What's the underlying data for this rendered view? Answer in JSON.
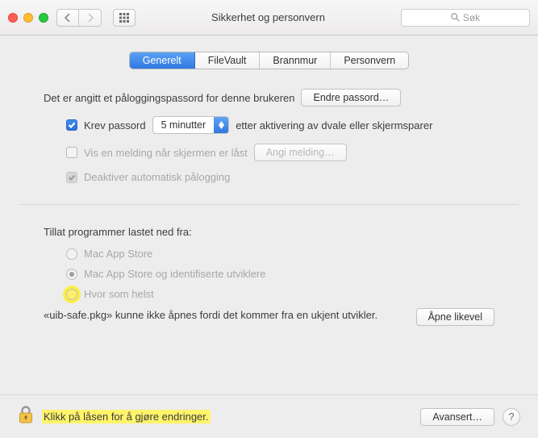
{
  "window": {
    "title": "Sikkerhet og personvern",
    "search_placeholder": "Søk"
  },
  "tabs": {
    "general": "Generelt",
    "filevault": "FileVault",
    "firewall": "Brannmur",
    "privacy": "Personvern"
  },
  "general": {
    "login_password_set": "Det er angitt et påloggingspassord for denne brukeren",
    "change_password": "Endre passord…",
    "require_password": "Krev passord",
    "delay_selected": "5 minutter",
    "after_sleep": "etter aktivering av dvale eller skjermsparer",
    "show_message": "Vis en melding når skjermen er låst",
    "set_message": "Angi melding…",
    "disable_auto_login": "Deaktiver automatisk pålogging"
  },
  "allow": {
    "title": "Tillat programmer lastet ned fra:",
    "mas": "Mac App Store",
    "mas_dev": "Mac App Store og identifiserte utviklere",
    "anywhere": "Hvor som helst",
    "blocked_msg": "«uib-safe.pkg» kunne ikke åpnes fordi det kommer fra en ukjent utvikler.",
    "open_anyway": "Åpne likevel"
  },
  "footer": {
    "lock_text": "Klikk på låsen for å gjøre endringer.",
    "advanced": "Avansert…"
  }
}
